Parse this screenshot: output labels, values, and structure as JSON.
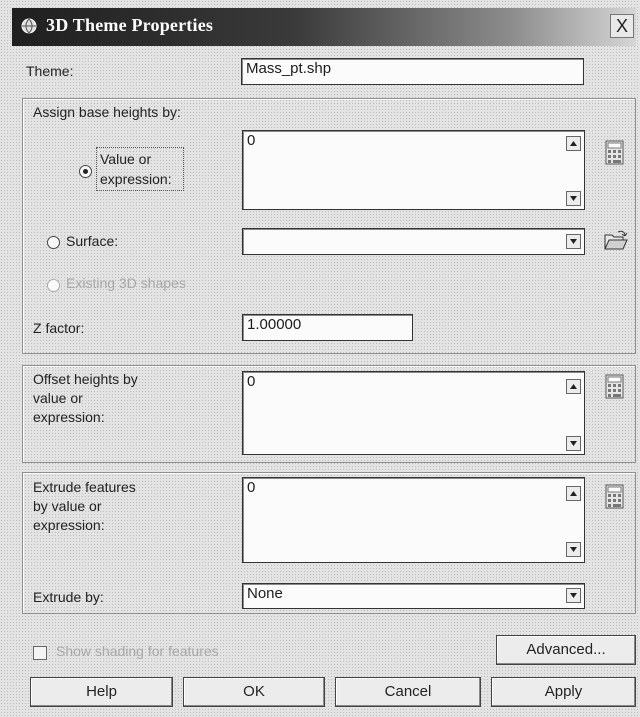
{
  "window": {
    "title": "3D Theme Properties",
    "close_symbol": "X"
  },
  "theme": {
    "label": "Theme:",
    "value": "Mass_pt.shp"
  },
  "base_heights": {
    "group_label": "Assign base heights by:",
    "value_option_label": "Value or expression:",
    "value_expression": "0",
    "surface_option_label": "Surface:",
    "surface_value": "",
    "existing_option_label": "Existing 3D shapes",
    "selected_option": "value_or_expression"
  },
  "z_factor": {
    "label": "Z factor:",
    "value": "1.00000"
  },
  "offset": {
    "label": "Offset heights by value or expression:",
    "value": "0"
  },
  "extrude": {
    "label": "Extrude features by value or expression:",
    "value": "0",
    "by_label": "Extrude by:",
    "by_value": "None"
  },
  "shading": {
    "label": "Show shading for features",
    "checked": false
  },
  "buttons": {
    "advanced": "Advanced...",
    "help": "Help",
    "ok": "OK",
    "cancel": "Cancel",
    "apply": "Apply"
  },
  "icons": {
    "app": "globe-icon",
    "calculator": "calculator-icon",
    "folder": "open-folder-icon",
    "scroll_up": "arrow-up-icon",
    "scroll_down": "arrow-down-icon",
    "dropdown": "dropdown-arrow-icon"
  }
}
